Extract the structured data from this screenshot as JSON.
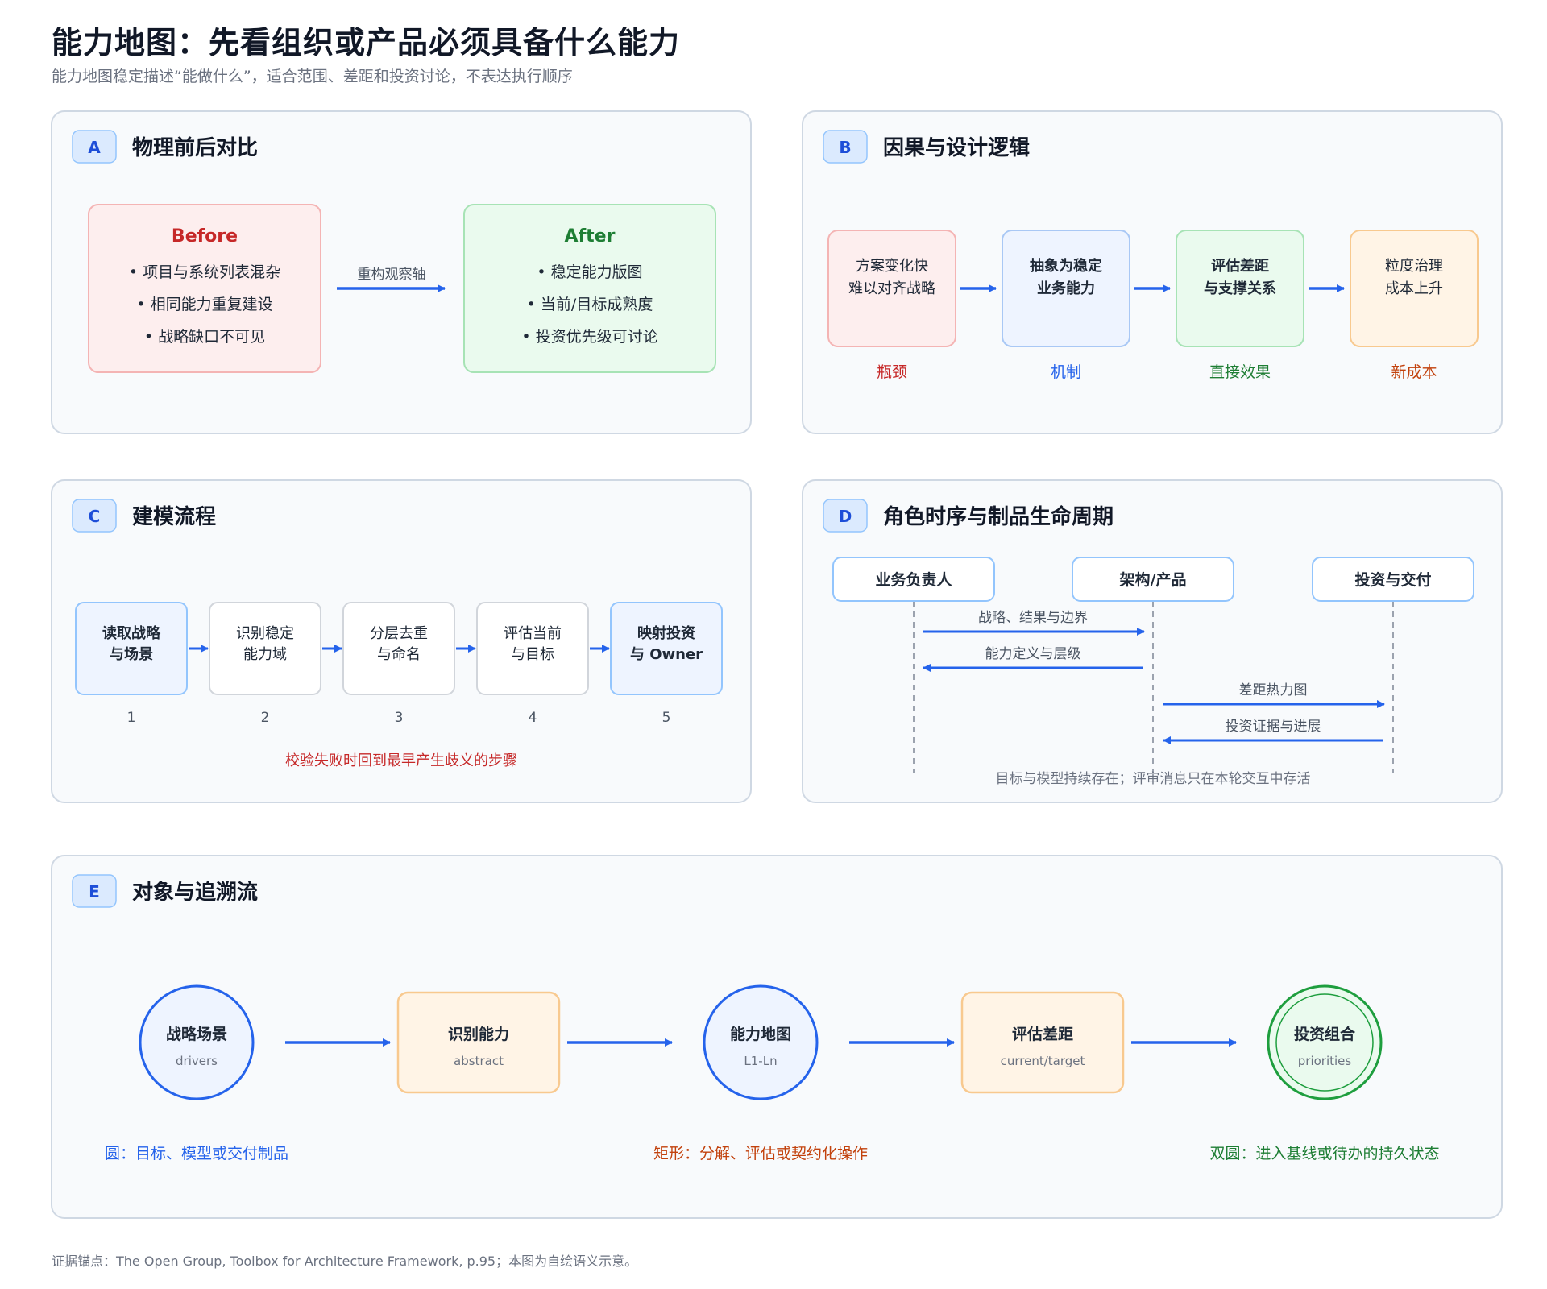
{
  "title": "能力地图：先看组织或产品必须具备什么能力",
  "subtitle": "能力地图稳定描述“能做什么”，适合范围、差距和投资讨论，不表达执行顺序",
  "footer": "证据锚点：The Open Group, Toolbox for Architecture Framework, p.95；本图为自绘语义示意。",
  "colors": {
    "accent_blue": "#2563eb",
    "red": "#c62828",
    "green": "#1e7e34",
    "orange": "#c2410c",
    "panel_border": "#cfd8e3",
    "panel_bg": "#f8fafc"
  },
  "panel_a": {
    "badge": "A",
    "title": "物理前后对比",
    "before": {
      "title": "Before",
      "items": [
        "• 项目与系统列表混杂",
        "• 相同能力重复建设",
        "• 战略缺口不可见"
      ]
    },
    "arrow_label": "重构观察轴",
    "after": {
      "title": "After",
      "items": [
        "• 稳定能力版图",
        "• 当前/目标成熟度",
        "• 投资优先级可讨论"
      ]
    }
  },
  "panel_b": {
    "badge": "B",
    "title": "因果与设计逻辑",
    "boxes": [
      {
        "lines": [
          "方案变化快",
          "难以对齐战略"
        ],
        "label": "瓶颈"
      },
      {
        "lines": [
          "抽象为稳定",
          "业务能力"
        ],
        "label": "机制"
      },
      {
        "lines": [
          "评估差距",
          "与支撑关系"
        ],
        "label": "直接效果"
      },
      {
        "lines": [
          "粒度治理",
          "成本上升"
        ],
        "label": "新成本"
      }
    ]
  },
  "panel_c": {
    "badge": "C",
    "title": "建模流程",
    "steps": [
      {
        "lines": [
          "读取战略",
          "与场景"
        ],
        "num": "1"
      },
      {
        "lines": [
          "识别稳定",
          "能力域"
        ],
        "num": "2"
      },
      {
        "lines": [
          "分层去重",
          "与命名"
        ],
        "num": "3"
      },
      {
        "lines": [
          "评估当前",
          "与目标"
        ],
        "num": "4"
      },
      {
        "lines": [
          "映射投资",
          "与 Owner"
        ],
        "num": "5"
      }
    ],
    "note": "校验失败时回到最早产生歧义的步骤"
  },
  "panel_d": {
    "badge": "D",
    "title": "角色时序与制品生命周期",
    "actors": [
      "业务负责人",
      "架构/产品",
      "投资与交付"
    ],
    "messages": [
      "战略、结果与边界",
      "能力定义与层级",
      "差距热力图",
      "投资证据与进展"
    ],
    "note": "目标与模型持续存在；评审消息只在本轮交互中存活"
  },
  "panel_e": {
    "badge": "E",
    "title": "对象与追溯流",
    "nodes": [
      {
        "title": "战略场景",
        "sub": "drivers"
      },
      {
        "title": "识别能力",
        "sub": "abstract"
      },
      {
        "title": "能力地图",
        "sub": "L1-Ln"
      },
      {
        "title": "评估差距",
        "sub": "current/target"
      },
      {
        "title": "投资组合",
        "sub": "priorities"
      }
    ],
    "legend": [
      "圆：目标、模型或交付制品",
      "矩形：分解、评估或契约化操作",
      "双圆：进入基线或待办的持久状态"
    ]
  }
}
